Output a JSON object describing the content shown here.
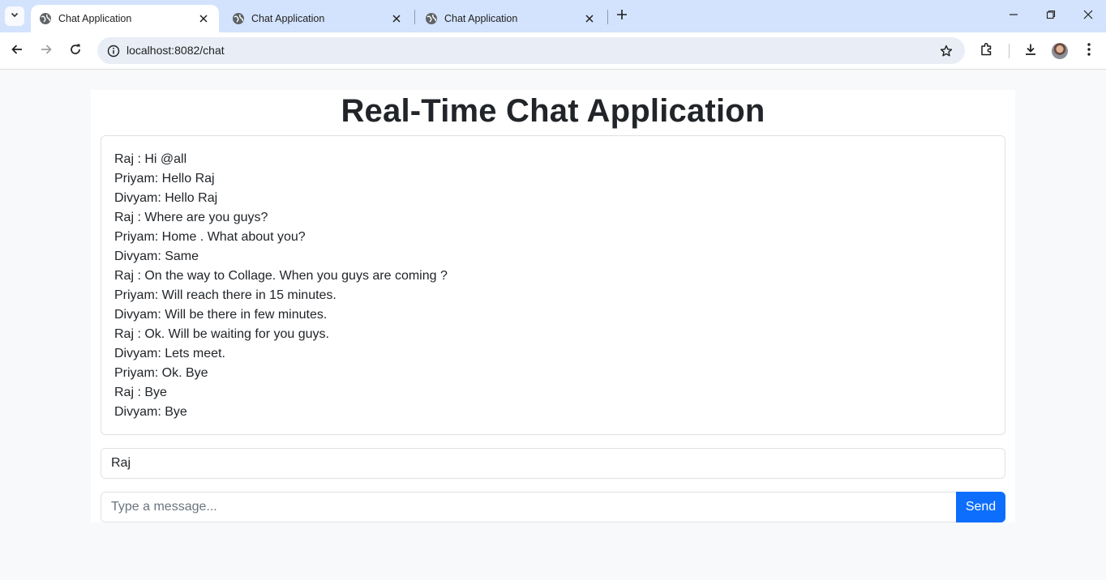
{
  "browser": {
    "tabs": [
      {
        "title": "Chat Application",
        "active": true
      },
      {
        "title": "Chat Application",
        "active": false
      },
      {
        "title": "Chat Application",
        "active": false
      }
    ],
    "url": "localhost:8082/chat",
    "icons": [
      "tab-search-icon",
      "globe-icon",
      "close-icon",
      "plus-icon",
      "minimize-icon",
      "restore-icon",
      "window-close-icon",
      "back-arrow-icon",
      "forward-arrow-icon",
      "reload-icon",
      "info-icon",
      "star-icon",
      "extensions-icon",
      "download-icon",
      "more-vert-icon"
    ]
  },
  "page": {
    "title": "Real-Time Chat Application",
    "messages": [
      "Raj : Hi @all",
      "Priyam: Hello Raj",
      "Divyam: Hello Raj",
      "Raj : Where are you guys?",
      "Priyam: Home . What about you?",
      "Divyam: Same",
      "Raj : On the way to Collage. When you guys are coming ?",
      "Priyam: Will reach there in 15 minutes.",
      "Divyam: Will be there in few minutes.",
      "Raj : Ok. Will be waiting for you guys.",
      "Divyam: Lets meet.",
      "Priyam: Ok. Bye",
      "Raj : Bye",
      "Divyam: Bye"
    ],
    "name_value": "Raj",
    "message_placeholder": "Type a message...",
    "send_label": "Send"
  },
  "colors": {
    "tabstrip_bg": "#d3e3fd",
    "omnibox_bg": "#e9eef6",
    "page_bg": "#f8f9fa",
    "text": "#212529",
    "send_button": "#0d6efd"
  }
}
